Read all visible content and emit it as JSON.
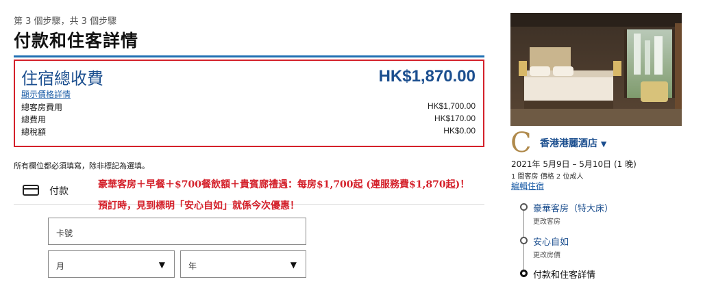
{
  "header": {
    "step_text": "第 3 個步驟，共 3 個步驟",
    "title": "付款和住客詳情"
  },
  "summary": {
    "total_label": "住宿總收費",
    "total_amount": "HK$1,870.00",
    "price_details_link": "顯示價格詳情",
    "rows": [
      {
        "label": "總客房費用",
        "value": "HK$1,700.00"
      },
      {
        "label": "總費用",
        "value": "HK$170.00"
      },
      {
        "label": "總稅額",
        "value": "HK$0.00"
      }
    ]
  },
  "required_note": "所有欄位都必須填寫，除非標記為選填。",
  "payment": {
    "section_label": "付款",
    "card_icon": "credit-card-icon",
    "card_number_placeholder": "卡號",
    "month_label": "月",
    "year_label": "年"
  },
  "promo": {
    "line1": "豪華客房＋早餐＋$700餐飲額＋貴賓廊禮遇：每房$1,700起 (連服務費$1,870起)！",
    "line2": "預訂時，見到標明「安心自如」就係今次優惠！",
    "color": "#d4202a"
  },
  "hotel": {
    "logo_letter": "C",
    "name": "香港港麗酒店",
    "dates": "2021年 5月9日 – 5月10日 (1 晚)",
    "guests": "1 間客房 價格 2 位成人",
    "edit_link": "編輯住宿"
  },
  "timeline": [
    {
      "title": "豪華客房（特大床）",
      "subtitle": "更改客房"
    },
    {
      "title": "安心自如",
      "subtitle": "更改房價"
    },
    {
      "title": "付款和住客詳情",
      "subtitle": ""
    }
  ],
  "colors": {
    "brand_blue": "#1c4f8f",
    "highlight_red": "#d4202a",
    "logo_gold": "#b08a4c"
  }
}
